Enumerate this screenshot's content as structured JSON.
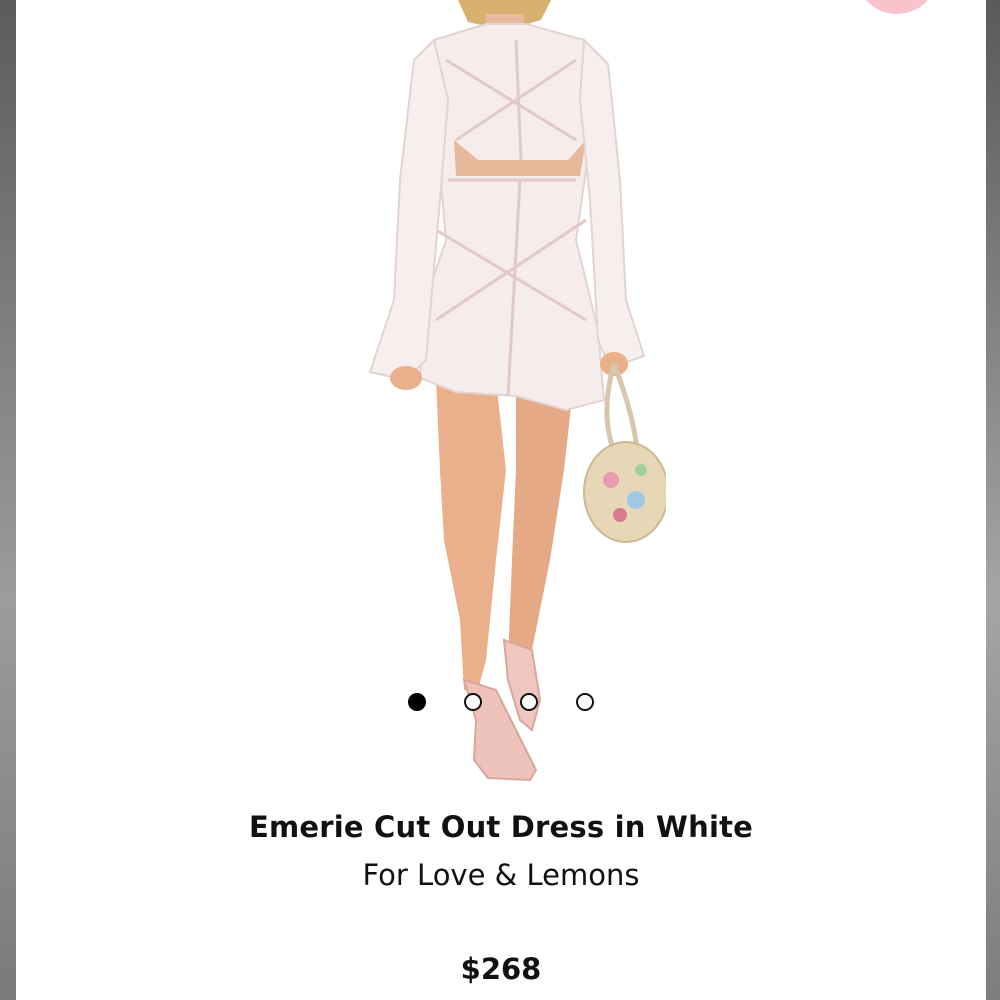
{
  "product": {
    "title": "Emerie Cut Out Dress in White",
    "brand": "For Love & Lemons",
    "price": "$268"
  },
  "carousel": {
    "slide_count": 4,
    "active_index": 0
  },
  "icons": [
    "favorite-button-icon"
  ],
  "colors": {
    "background": "#ffffff",
    "favorite_accent": "#f8c3cc",
    "text": "#111111",
    "dot_active": "#000000"
  }
}
